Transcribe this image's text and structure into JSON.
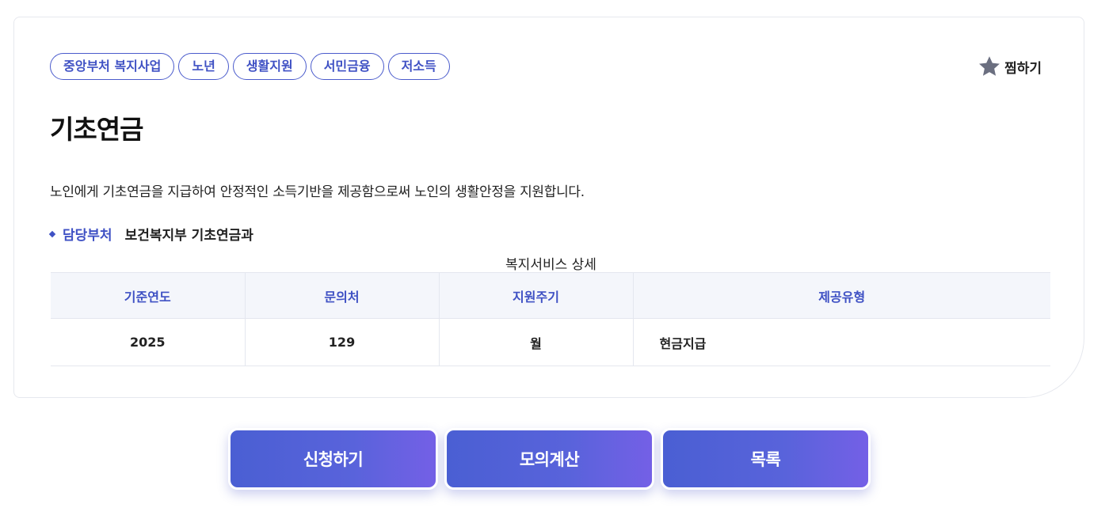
{
  "tags": [
    "중앙부처 복지사업",
    "노년",
    "생활지원",
    "서민금융",
    "저소득"
  ],
  "favorite": {
    "label": "찜하기",
    "icon": "star-icon"
  },
  "title": "기초연금",
  "description": "노인에게 기초연금을 지급하여 안정적인 소득기반을 제공함으로써 노인의 생활안정을 지원합니다.",
  "department": {
    "label": "담당부처",
    "value": "보건복지부 기초연금과"
  },
  "detail_table": {
    "caption": "복지서비스 상세",
    "headers": [
      "기준연도",
      "문의처",
      "지원주기",
      "제공유형"
    ],
    "rows": [
      [
        "2025",
        "129",
        "월",
        "현금지급"
      ]
    ]
  },
  "actions": {
    "apply": "신청하기",
    "simulate": "모의계산",
    "list": "목록"
  },
  "colors": {
    "accent": "#3f51c4",
    "button_start": "#4a5fd3",
    "button_end": "#7460e6"
  }
}
